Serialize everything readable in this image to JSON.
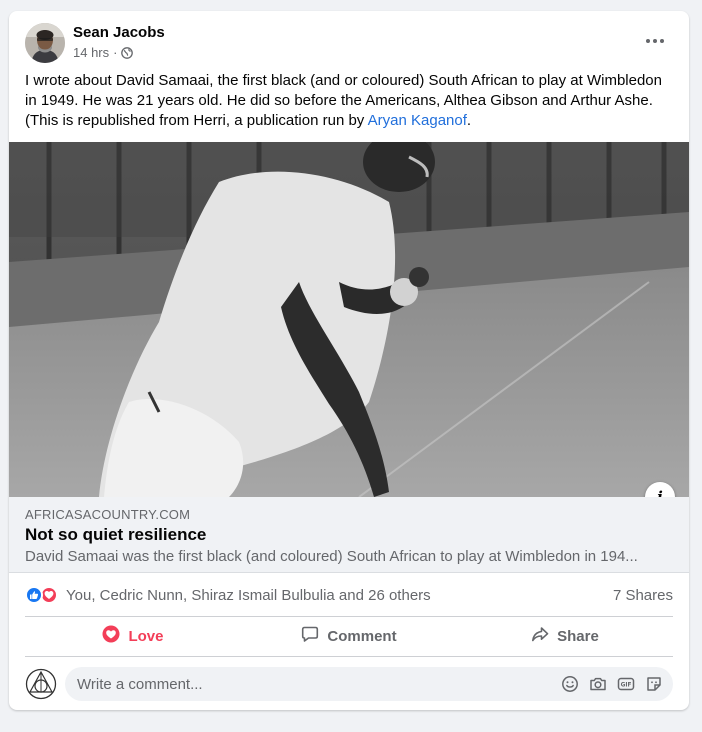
{
  "post": {
    "author": "Sean Jacobs",
    "time": "14 hrs",
    "separator": "·",
    "audience_icon": "globe-icon",
    "text_before_link": "I wrote about David Samaai, the first black (and or coloured) South African to play at Wimbledon in 1949. He was 21 years old. He did so before the Americans, Althea Gibson and Arthur Ashe. (This is republished from Herri, a publication run by ",
    "text_link": "Aryan Kaganof",
    "text_after_link": "."
  },
  "link_preview": {
    "domain": "AFRICASACOUNTRY.COM",
    "title": "Not so quiet resilience",
    "description": "David Samaai was the first black (and coloured) South African to play at Wimbledon in 194..."
  },
  "reactions": {
    "icons": [
      "like-icon",
      "love-icon"
    ],
    "names": "You, Cedric Nunn, Shiraz Ismail Bulbulia and 26 others",
    "shares": "7 Shares"
  },
  "actions": {
    "love": "Love",
    "comment": "Comment",
    "share": "Share"
  },
  "comment_box": {
    "placeholder": "Write a comment...",
    "tools": [
      "emoji-icon",
      "camera-icon",
      "gif-icon",
      "sticker-icon"
    ]
  },
  "colors": {
    "accent_blue": "#216fdb",
    "love_red": "#f33e58",
    "like_blue": "#1877f2"
  }
}
